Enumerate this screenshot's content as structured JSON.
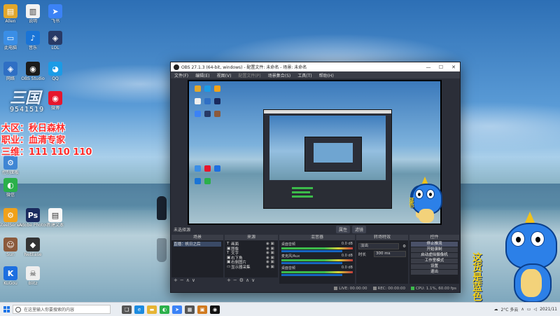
{
  "desktop": {
    "icons_left": [
      {
        "name": "home-folder-icon",
        "label": "Allen",
        "color": "#e2a72b",
        "glyph": "▤"
      },
      {
        "name": "computer-icon",
        "label": "此电脑",
        "color": "#3a8ee6",
        "glyph": "▭"
      },
      {
        "name": "network-icon",
        "label": "网络",
        "color": "#2f6fc4",
        "glyph": "◈"
      },
      {
        "name": "control-panel-icon",
        "label": "控制面板",
        "color": "#3f86d4",
        "glyph": "⚙"
      },
      {
        "name": "wechat-icon",
        "label": "微信",
        "color": "#2bb04a",
        "glyph": "◐"
      },
      {
        "name": "steelseries-icon",
        "label": "SteelSeries",
        "color": "#f0a11a",
        "glyph": "⚙"
      },
      {
        "name": "avatar-app-icon",
        "label": "Sun",
        "color": "#8b5a3c",
        "glyph": "☺"
      },
      {
        "name": "kugou-icon",
        "label": "KuGou",
        "color": "#1d6fe0",
        "glyph": "K"
      }
    ],
    "icons_col2": [
      {
        "name": "document-icon",
        "label": "说明",
        "color": "#f2f2f2",
        "glyph": "▥"
      },
      {
        "name": "music-icon",
        "label": "音乐",
        "color": "#1a74d6",
        "glyph": "♪"
      },
      {
        "name": "obs-studio-icon",
        "label": "OBS Studio",
        "color": "#1b1b1b",
        "glyph": "◉"
      },
      {
        "name": "photoshop-icon",
        "label": "Adobe Photoshop",
        "color": "#1a2a5e",
        "glyph": "Ps"
      },
      {
        "name": "game-icon",
        "label": "NetEase",
        "color": "#333",
        "glyph": "◆"
      },
      {
        "name": "skull-app-icon",
        "label": "Blitz",
        "color": "#eee",
        "glyph": "☠"
      }
    ],
    "icons_col3": [
      {
        "name": "feishu-icon",
        "label": "飞书",
        "color": "#3b82f6",
        "glyph": "➤"
      },
      {
        "name": "game-app-icon",
        "label": "LOL",
        "color": "#283a66",
        "glyph": "◈"
      },
      {
        "name": "qq-icon",
        "label": "QQ",
        "color": "#1b9be6",
        "glyph": "◕"
      },
      {
        "name": "weibo-icon",
        "label": "微博",
        "color": "#e6162d",
        "glyph": "◉"
      },
      {
        "name": "text-file-icon",
        "label": "新建文本",
        "color": "#f7f7f7",
        "glyph": "▤"
      }
    ],
    "overlay": {
      "logo": "三国",
      "number": "9541519",
      "line1": "大区：秋日森林",
      "line2": "职业：血清专家",
      "line3": "三维：111 110 110"
    }
  },
  "obs": {
    "title": "OBS 27.1.3 (64-bit, windows) - 配置文件: 未命名 - 场景: 未命名",
    "menu": [
      "文件(F)",
      "编辑(E)",
      "视图(V)",
      "配置文件(P)",
      "场景集合(S)",
      "工具(T)",
      "帮助(H)"
    ],
    "no_source_label": "未选择源",
    "tabs": [
      "属性",
      "滤镜"
    ],
    "docks": {
      "scenes": {
        "title": "场景",
        "items": [
          "直播：帆日之后"
        ]
      },
      "sources": {
        "title": "来源",
        "items": [
          {
            "name": "画面",
            "icon": "T"
          },
          {
            "name": "图像",
            "icon": "▣"
          },
          {
            "name": "文字",
            "icon": "T"
          },
          {
            "name": "右下角",
            "icon": "▣"
          },
          {
            "name": "右侧图片",
            "icon": "▣"
          },
          {
            "name": "显示器采集",
            "icon": "▭"
          }
        ]
      },
      "mixer": {
        "title": "混音器",
        "tracks": [
          {
            "name": "桌面音频",
            "db": "0.0 dB"
          },
          {
            "name": "麦克风/Aux",
            "db": "0.0 dB"
          },
          {
            "name": "桌面音频",
            "db": "0.0 dB"
          }
        ]
      },
      "transitions": {
        "title": "转场特效",
        "type": "淡出",
        "duration_label": "时长",
        "duration": "300 ms"
      },
      "controls": {
        "title": "控件",
        "buttons": [
          "停止推流",
          "开始录制",
          "启动虚拟摄像机",
          "工作室模式",
          "设置",
          "退出"
        ]
      }
    },
    "status": {
      "live": "LIVE: 00:00:00",
      "rec": "REC: 00:00:00",
      "cpu": "CPU: 1.1%, 60.00 fps"
    }
  },
  "mascot": {
    "text": "这货是蓝色",
    "sub": "蓝色"
  },
  "taskbar": {
    "search_placeholder": "在这里输入你要搜索的内容",
    "apps": [
      {
        "name": "task-view-icon",
        "color": "#555",
        "glyph": "❑"
      },
      {
        "name": "edge-icon",
        "color": "#1c8be0",
        "glyph": "e"
      },
      {
        "name": "file-explorer-icon",
        "color": "#e6b434",
        "glyph": "▬"
      },
      {
        "name": "wechat-taskbar-icon",
        "color": "#2bb04a",
        "glyph": "◐"
      },
      {
        "name": "feishu-taskbar-icon",
        "color": "#3b82f6",
        "glyph": "➤"
      },
      {
        "name": "store-icon",
        "color": "#555",
        "glyph": "▦"
      },
      {
        "name": "app-taskbar-icon",
        "color": "#d07a1f",
        "glyph": "▣"
      },
      {
        "name": "obs-taskbar-icon",
        "color": "#111",
        "glyph": "◉"
      }
    ],
    "weather": "2°C 多云",
    "time": "",
    "date": "2021/11"
  }
}
